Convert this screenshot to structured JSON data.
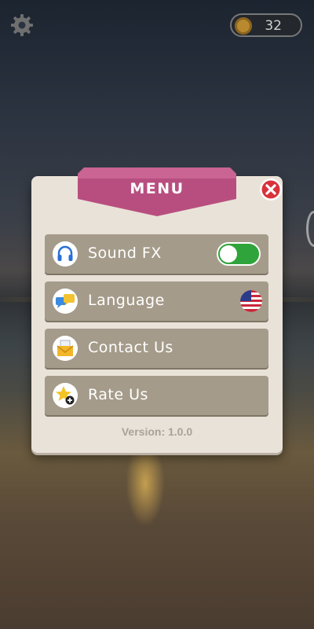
{
  "top_bar": {
    "settings_icon": "gear-icon",
    "coin_icon": "coin-icon",
    "coins": "32"
  },
  "menu": {
    "title": "MENU",
    "close_icon": "close-icon",
    "items": [
      {
        "label": "Sound FX",
        "icon": "headphones-icon",
        "control": "toggle",
        "toggle_on": true
      },
      {
        "label": "Language",
        "icon": "chat-bubbles-icon",
        "control": "flag",
        "flag": "us-flag-icon"
      },
      {
        "label": "Contact Us",
        "icon": "mail-icon"
      },
      {
        "label": "Rate Us",
        "icon": "star-plus-icon"
      }
    ],
    "version": "Version: 1.0.0"
  },
  "colors": {
    "ribbon": "#b84e7f",
    "panel": "#e9e2d8",
    "row": "#a59b8a",
    "toggle_on": "#2fa43a",
    "close": "#d9323b"
  }
}
